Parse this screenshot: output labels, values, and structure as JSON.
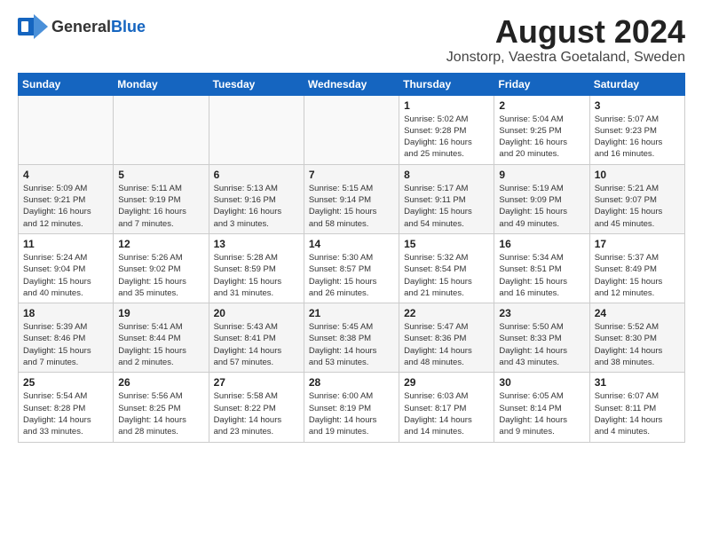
{
  "logo": {
    "general": "General",
    "blue": "Blue"
  },
  "title": "August 2024",
  "subtitle": "Jonstorp, Vaestra Goetaland, Sweden",
  "weekdays": [
    "Sunday",
    "Monday",
    "Tuesday",
    "Wednesday",
    "Thursday",
    "Friday",
    "Saturday"
  ],
  "weeks": [
    [
      {
        "day": "",
        "info": ""
      },
      {
        "day": "",
        "info": ""
      },
      {
        "day": "",
        "info": ""
      },
      {
        "day": "",
        "info": ""
      },
      {
        "day": "1",
        "info": "Sunrise: 5:02 AM\nSunset: 9:28 PM\nDaylight: 16 hours\nand 25 minutes."
      },
      {
        "day": "2",
        "info": "Sunrise: 5:04 AM\nSunset: 9:25 PM\nDaylight: 16 hours\nand 20 minutes."
      },
      {
        "day": "3",
        "info": "Sunrise: 5:07 AM\nSunset: 9:23 PM\nDaylight: 16 hours\nand 16 minutes."
      }
    ],
    [
      {
        "day": "4",
        "info": "Sunrise: 5:09 AM\nSunset: 9:21 PM\nDaylight: 16 hours\nand 12 minutes."
      },
      {
        "day": "5",
        "info": "Sunrise: 5:11 AM\nSunset: 9:19 PM\nDaylight: 16 hours\nand 7 minutes."
      },
      {
        "day": "6",
        "info": "Sunrise: 5:13 AM\nSunset: 9:16 PM\nDaylight: 16 hours\nand 3 minutes."
      },
      {
        "day": "7",
        "info": "Sunrise: 5:15 AM\nSunset: 9:14 PM\nDaylight: 15 hours\nand 58 minutes."
      },
      {
        "day": "8",
        "info": "Sunrise: 5:17 AM\nSunset: 9:11 PM\nDaylight: 15 hours\nand 54 minutes."
      },
      {
        "day": "9",
        "info": "Sunrise: 5:19 AM\nSunset: 9:09 PM\nDaylight: 15 hours\nand 49 minutes."
      },
      {
        "day": "10",
        "info": "Sunrise: 5:21 AM\nSunset: 9:07 PM\nDaylight: 15 hours\nand 45 minutes."
      }
    ],
    [
      {
        "day": "11",
        "info": "Sunrise: 5:24 AM\nSunset: 9:04 PM\nDaylight: 15 hours\nand 40 minutes."
      },
      {
        "day": "12",
        "info": "Sunrise: 5:26 AM\nSunset: 9:02 PM\nDaylight: 15 hours\nand 35 minutes."
      },
      {
        "day": "13",
        "info": "Sunrise: 5:28 AM\nSunset: 8:59 PM\nDaylight: 15 hours\nand 31 minutes."
      },
      {
        "day": "14",
        "info": "Sunrise: 5:30 AM\nSunset: 8:57 PM\nDaylight: 15 hours\nand 26 minutes."
      },
      {
        "day": "15",
        "info": "Sunrise: 5:32 AM\nSunset: 8:54 PM\nDaylight: 15 hours\nand 21 minutes."
      },
      {
        "day": "16",
        "info": "Sunrise: 5:34 AM\nSunset: 8:51 PM\nDaylight: 15 hours\nand 16 minutes."
      },
      {
        "day": "17",
        "info": "Sunrise: 5:37 AM\nSunset: 8:49 PM\nDaylight: 15 hours\nand 12 minutes."
      }
    ],
    [
      {
        "day": "18",
        "info": "Sunrise: 5:39 AM\nSunset: 8:46 PM\nDaylight: 15 hours\nand 7 minutes."
      },
      {
        "day": "19",
        "info": "Sunrise: 5:41 AM\nSunset: 8:44 PM\nDaylight: 15 hours\nand 2 minutes."
      },
      {
        "day": "20",
        "info": "Sunrise: 5:43 AM\nSunset: 8:41 PM\nDaylight: 14 hours\nand 57 minutes."
      },
      {
        "day": "21",
        "info": "Sunrise: 5:45 AM\nSunset: 8:38 PM\nDaylight: 14 hours\nand 53 minutes."
      },
      {
        "day": "22",
        "info": "Sunrise: 5:47 AM\nSunset: 8:36 PM\nDaylight: 14 hours\nand 48 minutes."
      },
      {
        "day": "23",
        "info": "Sunrise: 5:50 AM\nSunset: 8:33 PM\nDaylight: 14 hours\nand 43 minutes."
      },
      {
        "day": "24",
        "info": "Sunrise: 5:52 AM\nSunset: 8:30 PM\nDaylight: 14 hours\nand 38 minutes."
      }
    ],
    [
      {
        "day": "25",
        "info": "Sunrise: 5:54 AM\nSunset: 8:28 PM\nDaylight: 14 hours\nand 33 minutes."
      },
      {
        "day": "26",
        "info": "Sunrise: 5:56 AM\nSunset: 8:25 PM\nDaylight: 14 hours\nand 28 minutes."
      },
      {
        "day": "27",
        "info": "Sunrise: 5:58 AM\nSunset: 8:22 PM\nDaylight: 14 hours\nand 23 minutes."
      },
      {
        "day": "28",
        "info": "Sunrise: 6:00 AM\nSunset: 8:19 PM\nDaylight: 14 hours\nand 19 minutes."
      },
      {
        "day": "29",
        "info": "Sunrise: 6:03 AM\nSunset: 8:17 PM\nDaylight: 14 hours\nand 14 minutes."
      },
      {
        "day": "30",
        "info": "Sunrise: 6:05 AM\nSunset: 8:14 PM\nDaylight: 14 hours\nand 9 minutes."
      },
      {
        "day": "31",
        "info": "Sunrise: 6:07 AM\nSunset: 8:11 PM\nDaylight: 14 hours\nand 4 minutes."
      }
    ]
  ]
}
